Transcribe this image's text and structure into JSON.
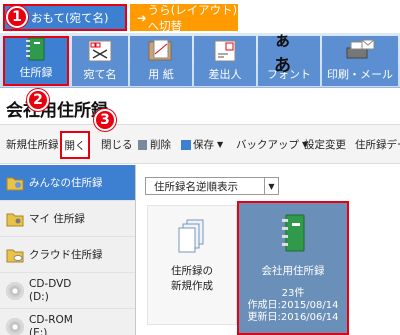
{
  "mode_tabs": {
    "omote_label": "おもて(宛て名)",
    "ura_label": "うら(レイアウト)へ切替",
    "ura_arrow": "➔"
  },
  "badges": {
    "one": "1",
    "two": "2",
    "three": "3"
  },
  "ribbon": {
    "buttons": [
      {
        "label": "住所録"
      },
      {
        "label": "宛て名"
      },
      {
        "label": "用 紙"
      },
      {
        "label": "差出人"
      },
      {
        "label": "フォント"
      },
      {
        "label": "印刷・メール"
      }
    ],
    "font_glyph": "ぁあ"
  },
  "title": "会社用住所録",
  "toolbar": {
    "new_book": "新規住所録",
    "open": "開く",
    "close": "閉じる",
    "delete": "削除",
    "save": "保存",
    "backup": "バックアップ",
    "settings": "設定変更",
    "book_data": "住所録デー"
  },
  "sidebar": {
    "items": [
      {
        "label": "みんなの住所録"
      },
      {
        "label": "マイ 住所録"
      },
      {
        "label": "クラウド住所録"
      },
      {
        "label": "CD-DVD",
        "drive": "(D:)"
      },
      {
        "label": "CD-ROM",
        "drive": "(E:)"
      }
    ]
  },
  "main": {
    "sort_option": "住所録名逆順表示",
    "new_card": {
      "line1": "住所録の",
      "line2": "新規作成"
    },
    "book_card": {
      "name": "会社用住所録",
      "count": "23件",
      "created": "作成日:2015/08/14",
      "updated": "更新日:2016/06/14"
    }
  },
  "colors": {
    "accent": "#3d7fd1",
    "highlight": "#e8000f",
    "orange": "#ff9a00",
    "book": "#6a8fb8"
  }
}
